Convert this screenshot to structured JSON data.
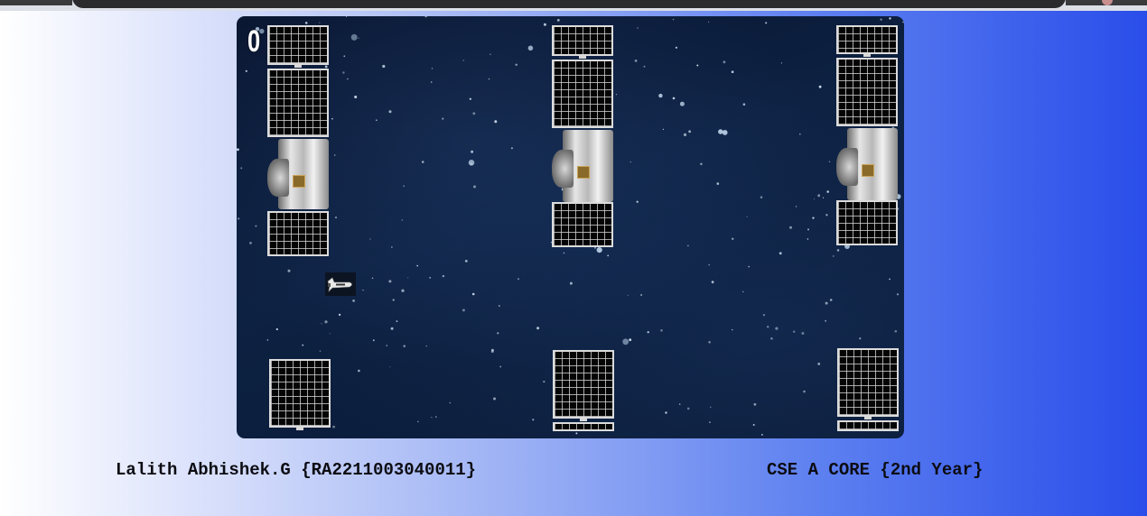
{
  "game": {
    "score": "0",
    "colors": {
      "background": "#0b1a38",
      "panel_grid": "#dcdcdc",
      "page_gradient_start": "#ffffff",
      "page_gradient_end": "#2a4dea"
    }
  },
  "footer": {
    "student": "Lalith Abhishek.G {RA2211003040011}",
    "class_info": "CSE A CORE {2nd Year}"
  }
}
